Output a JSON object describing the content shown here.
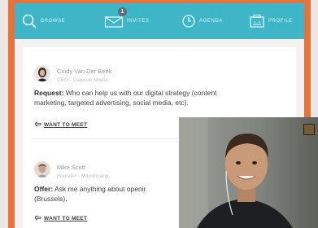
{
  "nav": {
    "items": [
      {
        "key": "browse",
        "label": "BROWSE",
        "icon": "search-icon"
      },
      {
        "key": "invites",
        "label": "INVITES",
        "icon": "envelope-icon",
        "badge": "1"
      },
      {
        "key": "agenda",
        "label": "AGENDA",
        "icon": "clock-icon"
      },
      {
        "key": "profile",
        "label": "PROFILE",
        "icon": "profile-card-icon"
      }
    ]
  },
  "posts": [
    {
      "name": "Cindy Van Der Beek",
      "role": "CEO - Dawson Media",
      "kind": "Request:",
      "text_line1": " Who can help us with our digital strategy (content",
      "text_line2": "marketing, targeted advertising, social media, etc).",
      "meet_label": "WANT TO MEET"
    },
    {
      "name": "Mike Scott",
      "role": "Founder - Mikompany",
      "kind": "Offer:",
      "text_line1": " Ask me anything about openir",
      "text_line2": "(Brussels).",
      "meet_label": "WANT TO MEET"
    }
  ],
  "colors": {
    "frame": "#e8743b",
    "nav": "#3fb6c8",
    "background": "#f3f2f0"
  }
}
